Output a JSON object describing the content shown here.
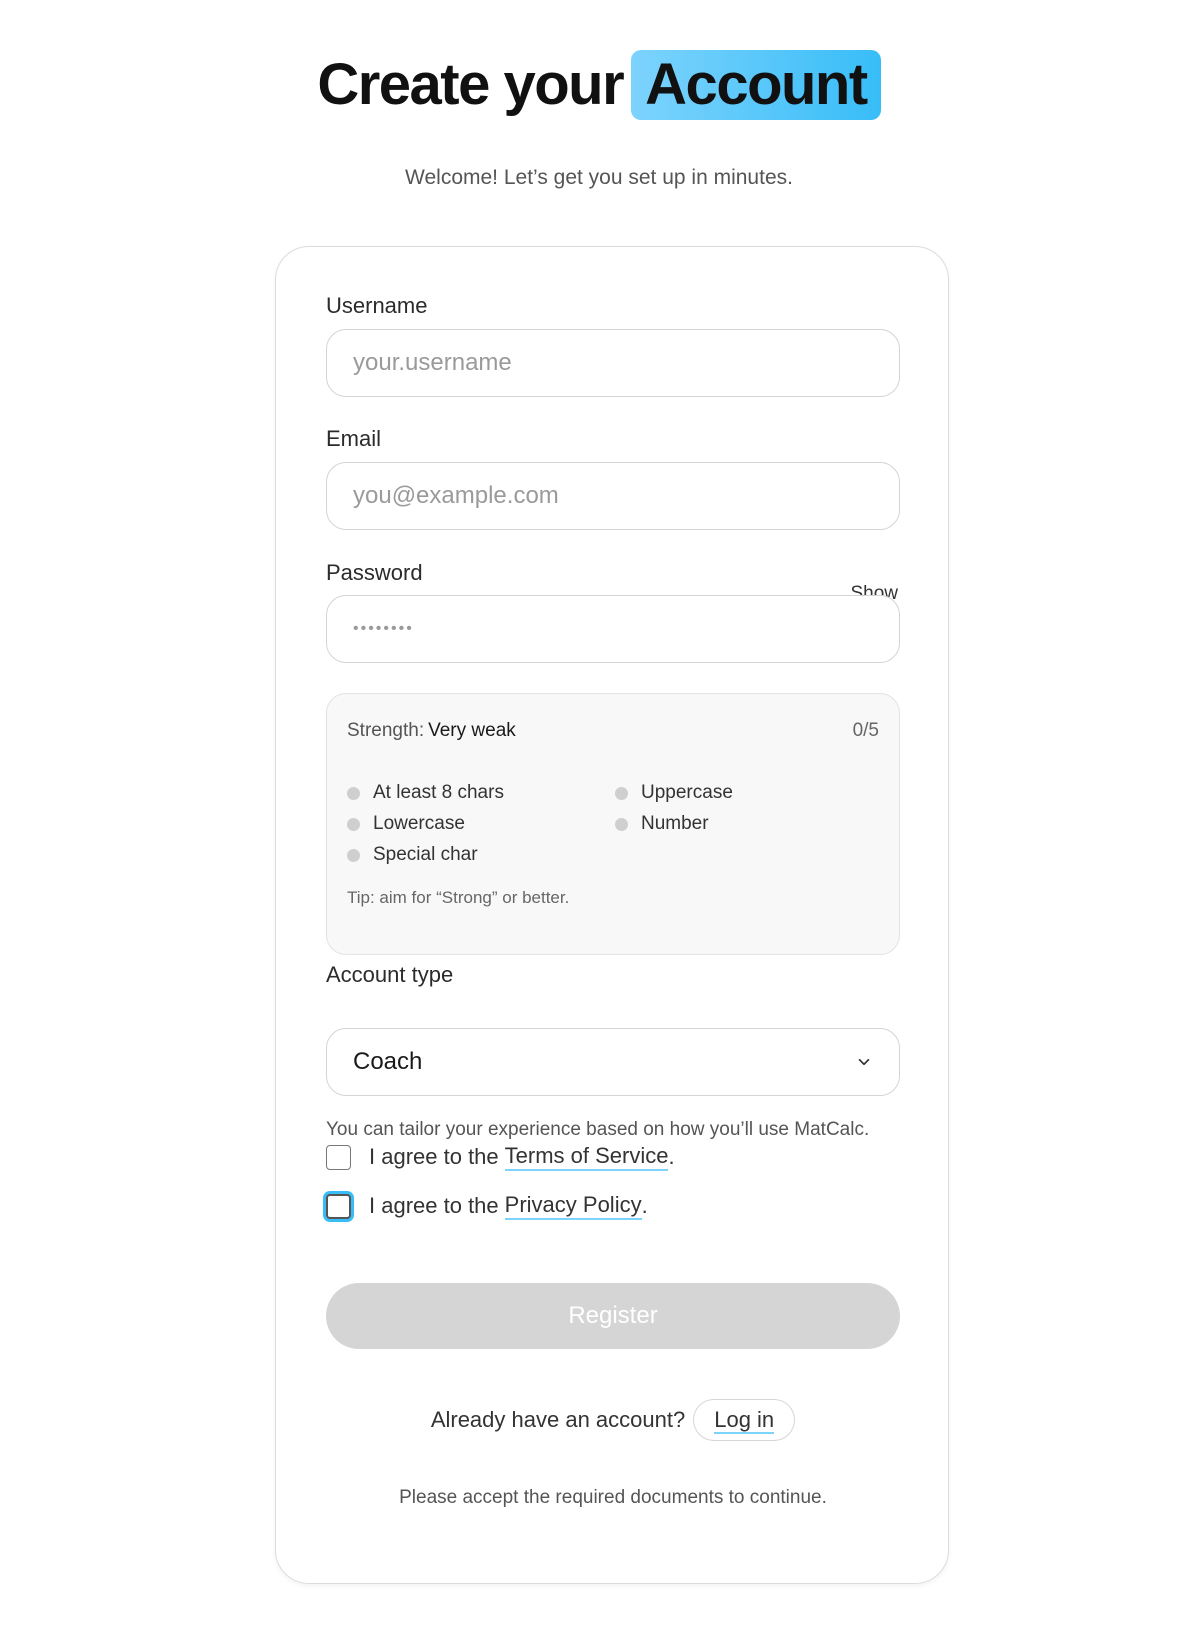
{
  "header": {
    "title_plain": "Create your",
    "title_highlight": "Account",
    "subtitle": "Welcome! Let’s get you set up in minutes."
  },
  "form": {
    "username": {
      "label": "Username",
      "placeholder": "your.username"
    },
    "email": {
      "label": "Email",
      "placeholder": "you@example.com"
    },
    "password": {
      "label": "Password",
      "show_label": "Show",
      "masked_value": "••••••••"
    },
    "strength": {
      "label": "Strength:",
      "value": "Very weak",
      "score": "0/5",
      "requirements": [
        "At least 8 chars",
        "Uppercase",
        "Lowercase",
        "Number",
        "Special char"
      ],
      "tip": "Tip: aim for “Strong” or better."
    },
    "account_type": {
      "label": "Account type",
      "selected": "Coach",
      "hint": "You can tailor your experience based on how you’ll use MatCalc."
    },
    "agreements": {
      "prefix": "I agree to the",
      "terms": "Terms of Service",
      "privacy": "Privacy Policy",
      "period": "."
    },
    "register_label": "Register",
    "login_prompt": "Already have an account?",
    "login_label": "Log in",
    "footnote": "Please accept the required documents to continue."
  },
  "colors": {
    "accent": "#38bdf8",
    "accent_light": "#7dd3fc",
    "disabled": "#d5d5d5"
  }
}
